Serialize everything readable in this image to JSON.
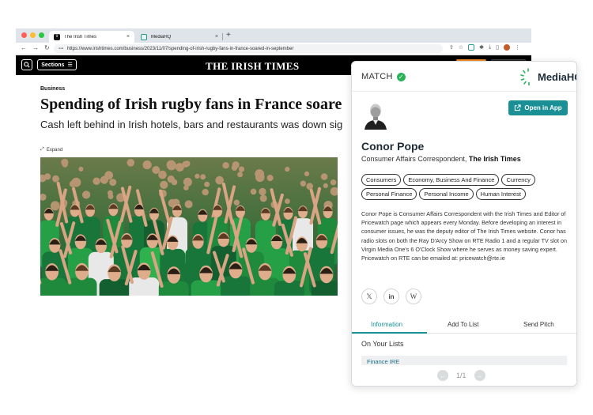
{
  "browser": {
    "tabs": [
      {
        "label": "The Irish Times",
        "favicon": "irish-times-icon",
        "active": true
      },
      {
        "label": "MediaHQ",
        "favicon": "mediahq-icon",
        "active": false
      }
    ],
    "new_tab": "+",
    "close": "×",
    "url": "https://www.irishtimes.com/business/2023/11/07/spending-of-irish-rugby-fans-in-france-soared-in-september"
  },
  "site": {
    "search_icon": "search-icon",
    "sections_label": "Sections",
    "masthead": "THE IRISH TIMES"
  },
  "article": {
    "category": "Business",
    "headline": "Spending of Irish rugby fans in France soare",
    "standfirst": "Cash left behind in Irish hotels, bars and restaurants was down sig",
    "expand_label": "Expand"
  },
  "panel": {
    "match_label": "MATCH",
    "logo_text": "MediaHQ",
    "open_app_label": "Open in App",
    "name": "Conor Pope",
    "role": "Consumer Affairs Correspondent,",
    "outlet": "The Irish Times",
    "tags": [
      "Consumers",
      "Economy, Business And Finance",
      "Currency",
      "Personal Finance",
      "Personal Income",
      "Human Interest"
    ],
    "bio": "Conor Pope is Consumer Affairs Correspondent with the Irish Times and Editor of Pricewatch page which appears every Monday. Before developing an interest in consumer issues, he was the deputy editor of The Irish Times website. Conor has radio slots on both the Ray D'Arcy Show on RTE Radio 1 and a regular TV slot on Virgin Media One's 6 O'Clock Show where he serves as money saving expert. Pricewatch on RTE can be emailed at: pricewatch@rte.ie",
    "socials": {
      "x": "𝕏",
      "linkedin": "in",
      "wikipedia": "W"
    },
    "tabs": {
      "info": "Information",
      "add": "Add To List",
      "pitch": "Send Pitch"
    },
    "lists_title": "On Your Lists",
    "list_items": [
      "Finance IRE"
    ],
    "pager": "1/1",
    "accent": "#1a8f95"
  }
}
